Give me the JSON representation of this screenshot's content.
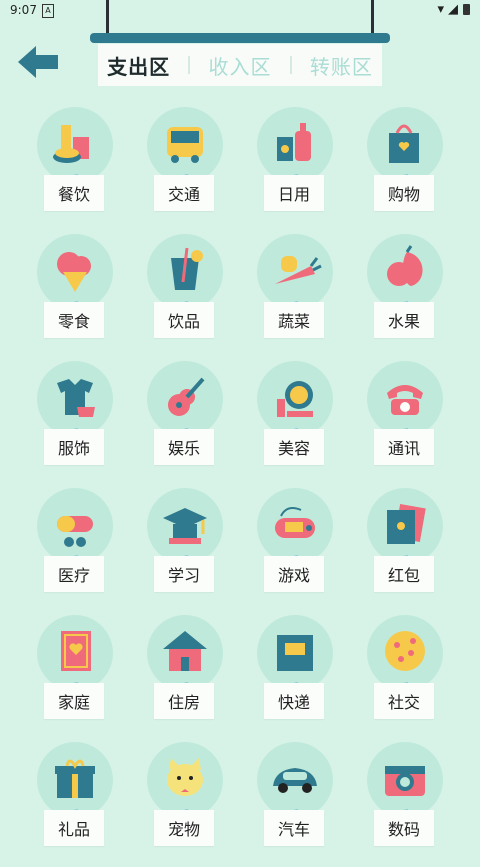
{
  "status_bar": {
    "time": "9:07",
    "app_icon": "A"
  },
  "header": {
    "tabs": [
      {
        "label": "支出区",
        "active": true
      },
      {
        "label": "收入区",
        "active": false
      },
      {
        "label": "转账区",
        "active": false
      }
    ],
    "back_icon": "back-arrow-icon"
  },
  "categories": [
    {
      "label": "餐饮",
      "icon": "food-icon"
    },
    {
      "label": "交通",
      "icon": "bus-icon"
    },
    {
      "label": "日用",
      "icon": "daily-icon"
    },
    {
      "label": "购物",
      "icon": "shopping-bag-icon"
    },
    {
      "label": "零食",
      "icon": "snack-icon"
    },
    {
      "label": "饮品",
      "icon": "drink-icon"
    },
    {
      "label": "蔬菜",
      "icon": "vegetable-icon"
    },
    {
      "label": "水果",
      "icon": "fruit-icon"
    },
    {
      "label": "服饰",
      "icon": "clothes-icon"
    },
    {
      "label": "娱乐",
      "icon": "guitar-icon"
    },
    {
      "label": "美容",
      "icon": "makeup-icon"
    },
    {
      "label": "通讯",
      "icon": "phone-icon"
    },
    {
      "label": "医疗",
      "icon": "pill-icon"
    },
    {
      "label": "学习",
      "icon": "graduation-cap-icon"
    },
    {
      "label": "游戏",
      "icon": "gamepad-icon"
    },
    {
      "label": "红包",
      "icon": "red-envelope-icon"
    },
    {
      "label": "家庭",
      "icon": "family-book-icon"
    },
    {
      "label": "住房",
      "icon": "house-icon"
    },
    {
      "label": "快递",
      "icon": "package-icon"
    },
    {
      "label": "社交",
      "icon": "pizza-icon"
    },
    {
      "label": "礼品",
      "icon": "gift-icon"
    },
    {
      "label": "宠物",
      "icon": "cat-icon"
    },
    {
      "label": "汽车",
      "icon": "car-icon"
    },
    {
      "label": "数码",
      "icon": "camera-icon"
    }
  ],
  "colors": {
    "background": "#d7f3e8",
    "circle": "#bfeadb",
    "accent_pink": "#ef6a7a",
    "accent_teal": "#2f7a8e",
    "tape": "#7cc3e0"
  }
}
